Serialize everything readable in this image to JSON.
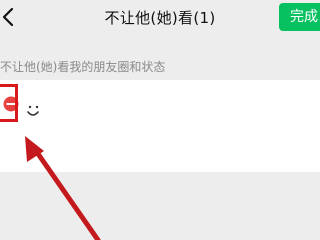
{
  "header": {
    "title": "不让他(她)看(1)",
    "done_label": "完成"
  },
  "section": {
    "label": "不让他(她)看我的朋友圈和状态"
  },
  "colors": {
    "accent": "#07c160",
    "remove": "#e64340",
    "highlight": "#d7191c"
  },
  "icons": {
    "back": "chevron-left-icon",
    "remove": "remove-circle-icon"
  }
}
